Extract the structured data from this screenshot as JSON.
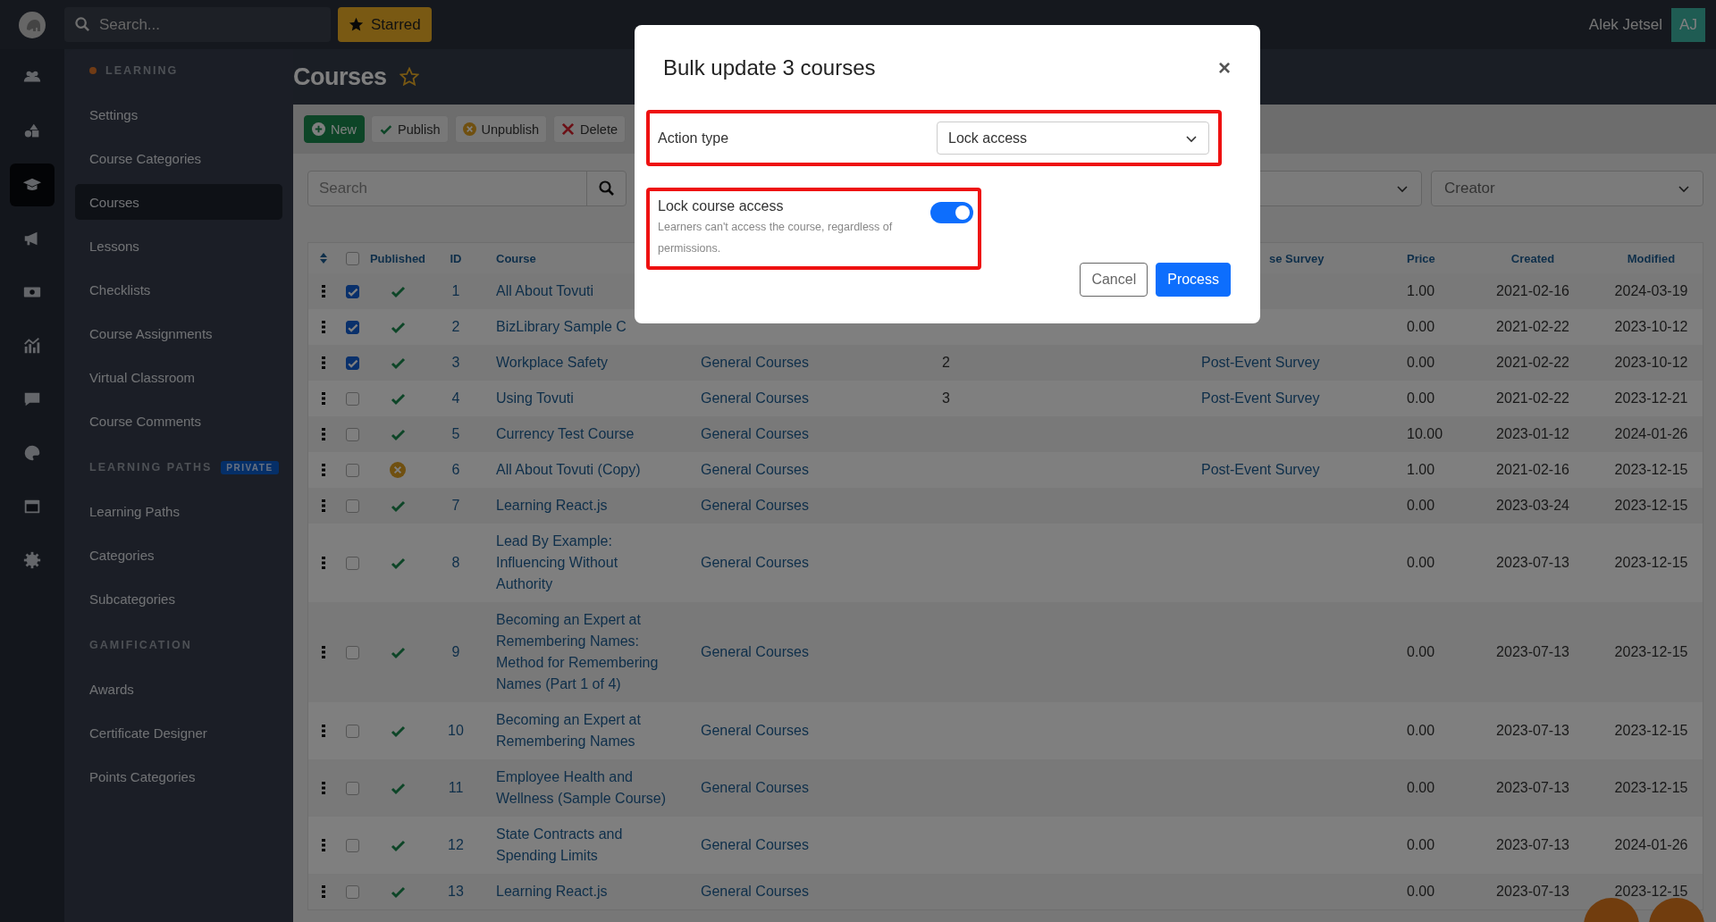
{
  "topbar": {
    "search": {
      "placeholder": "Search..."
    },
    "starred_button": "Starred",
    "user_name": "Alek Jetsel",
    "avatar_initials": "AJ"
  },
  "rail": [
    {
      "selected": false
    },
    {
      "selected": false
    },
    {
      "selected": true
    },
    {
      "selected": false
    },
    {
      "selected": false
    },
    {
      "selected": false
    },
    {
      "selected": false
    },
    {
      "selected": false
    },
    {
      "selected": false
    },
    {
      "selected": false
    }
  ],
  "sidebar": {
    "sections": [
      {
        "title": "LEARNING",
        "dot": true,
        "items": [
          {
            "label": "Settings",
            "selected": false
          },
          {
            "label": "Course Categories",
            "selected": false
          },
          {
            "label": "Courses",
            "selected": true
          },
          {
            "label": "Lessons",
            "selected": false
          },
          {
            "label": "Checklists",
            "selected": false
          },
          {
            "label": "Course Assignments",
            "selected": false
          },
          {
            "label": "Virtual Classroom",
            "selected": false
          },
          {
            "label": "Course Comments",
            "selected": false
          }
        ]
      },
      {
        "title": "LEARNING PATHS",
        "dot": false,
        "badge": "PRIVATE",
        "items": [
          {
            "label": "Learning Paths",
            "selected": false
          },
          {
            "label": "Categories",
            "selected": false
          },
          {
            "label": "Subcategories",
            "selected": false
          }
        ]
      },
      {
        "title": "GAMIFICATION",
        "dot": false,
        "items": [
          {
            "label": "Awards",
            "selected": false
          },
          {
            "label": "Certificate Designer",
            "selected": false
          },
          {
            "label": "Points Categories",
            "selected": false
          }
        ]
      }
    ]
  },
  "page": {
    "title": "Courses",
    "starred": false
  },
  "toolbar": [
    {
      "label": "New",
      "kind": "new"
    },
    {
      "label": "Publish",
      "kind": "publish"
    },
    {
      "label": "Unpublish",
      "kind": "unpublish"
    },
    {
      "label": "Delete",
      "kind": "delete"
    }
  ],
  "filters": {
    "search": {
      "placeholder": "Search"
    },
    "creator": {
      "placeholder": "Creator"
    }
  },
  "table": {
    "all_selected": false,
    "columns": {
      "published": "Published",
      "id": "ID",
      "course": "Course",
      "survey": "se Survey",
      "price": "Price",
      "created": "Created",
      "modified": "Modified"
    },
    "rows": [
      {
        "selected": true,
        "published": true,
        "id": "1",
        "course": "All About Tovuti",
        "price": "1.00",
        "created": "2021-02-16",
        "modified": "2024-03-19"
      },
      {
        "selected": true,
        "published": true,
        "id": "2",
        "course": "BizLibrary Sample C",
        "price": "0.00",
        "created": "2021-02-22",
        "modified": "2023-10-12"
      },
      {
        "selected": true,
        "published": true,
        "id": "3",
        "course": "Workplace Safety",
        "category": "General Courses",
        "count": "2",
        "survey": "Post-Event Survey",
        "price": "0.00",
        "created": "2021-02-22",
        "modified": "2023-10-12"
      },
      {
        "selected": false,
        "published": true,
        "id": "4",
        "course": "Using Tovuti",
        "category": "General Courses",
        "count": "3",
        "survey": "Post-Event Survey",
        "price": "0.00",
        "created": "2021-02-22",
        "modified": "2023-12-21"
      },
      {
        "selected": false,
        "published": true,
        "id": "5",
        "course": "Currency Test Course",
        "category": "General Courses",
        "price": "10.00",
        "created": "2023-01-12",
        "modified": "2024-01-26"
      },
      {
        "selected": false,
        "published": false,
        "id": "6",
        "course": "All About Tovuti (Copy)",
        "category": "General Courses",
        "survey": "Post-Event Survey",
        "price": "1.00",
        "created": "2021-02-16",
        "modified": "2023-12-15"
      },
      {
        "selected": false,
        "published": true,
        "id": "7",
        "course": "Learning React.js",
        "category": "General Courses",
        "price": "0.00",
        "created": "2023-03-24",
        "modified": "2023-12-15"
      },
      {
        "selected": false,
        "published": true,
        "id": "8",
        "course": "Lead By Example: Influencing Without Authority",
        "category": "General Courses",
        "price": "0.00",
        "created": "2023-07-13",
        "modified": "2023-12-15"
      },
      {
        "selected": false,
        "published": true,
        "id": "9",
        "course": "Becoming an Expert at Remembering Names: Method for Remembering Names (Part 1 of 4)",
        "category": "General Courses",
        "price": "0.00",
        "created": "2023-07-13",
        "modified": "2023-12-15"
      },
      {
        "selected": false,
        "published": true,
        "id": "10",
        "course": "Becoming an Expert at Remembering Names",
        "category": "General Courses",
        "price": "0.00",
        "created": "2023-07-13",
        "modified": "2023-12-15"
      },
      {
        "selected": false,
        "published": true,
        "id": "11",
        "course": "Employee Health and Wellness (Sample Course)",
        "category": "General Courses",
        "price": "0.00",
        "created": "2023-07-13",
        "modified": "2023-12-15"
      },
      {
        "selected": false,
        "published": true,
        "id": "12",
        "course": "State Contracts and Spending Limits",
        "category": "General Courses",
        "price": "0.00",
        "created": "2023-07-13",
        "modified": "2024-01-26"
      },
      {
        "selected": false,
        "published": true,
        "id": "13",
        "course": "Learning React.js",
        "category": "General Courses",
        "price": "0.00",
        "created": "2023-07-13",
        "modified": "2023-12-15"
      }
    ]
  },
  "modal": {
    "title": "Bulk update 3 courses",
    "close": "×",
    "action_label": "Action type",
    "action_value": "Lock access",
    "toggle": {
      "label": "Lock course access",
      "help": "Learners can't access the course, regardless of permissions.",
      "on": true
    },
    "buttons": [
      {
        "label": "Cancel",
        "kind": "secondary"
      },
      {
        "label": "Process",
        "kind": "primary"
      }
    ]
  }
}
